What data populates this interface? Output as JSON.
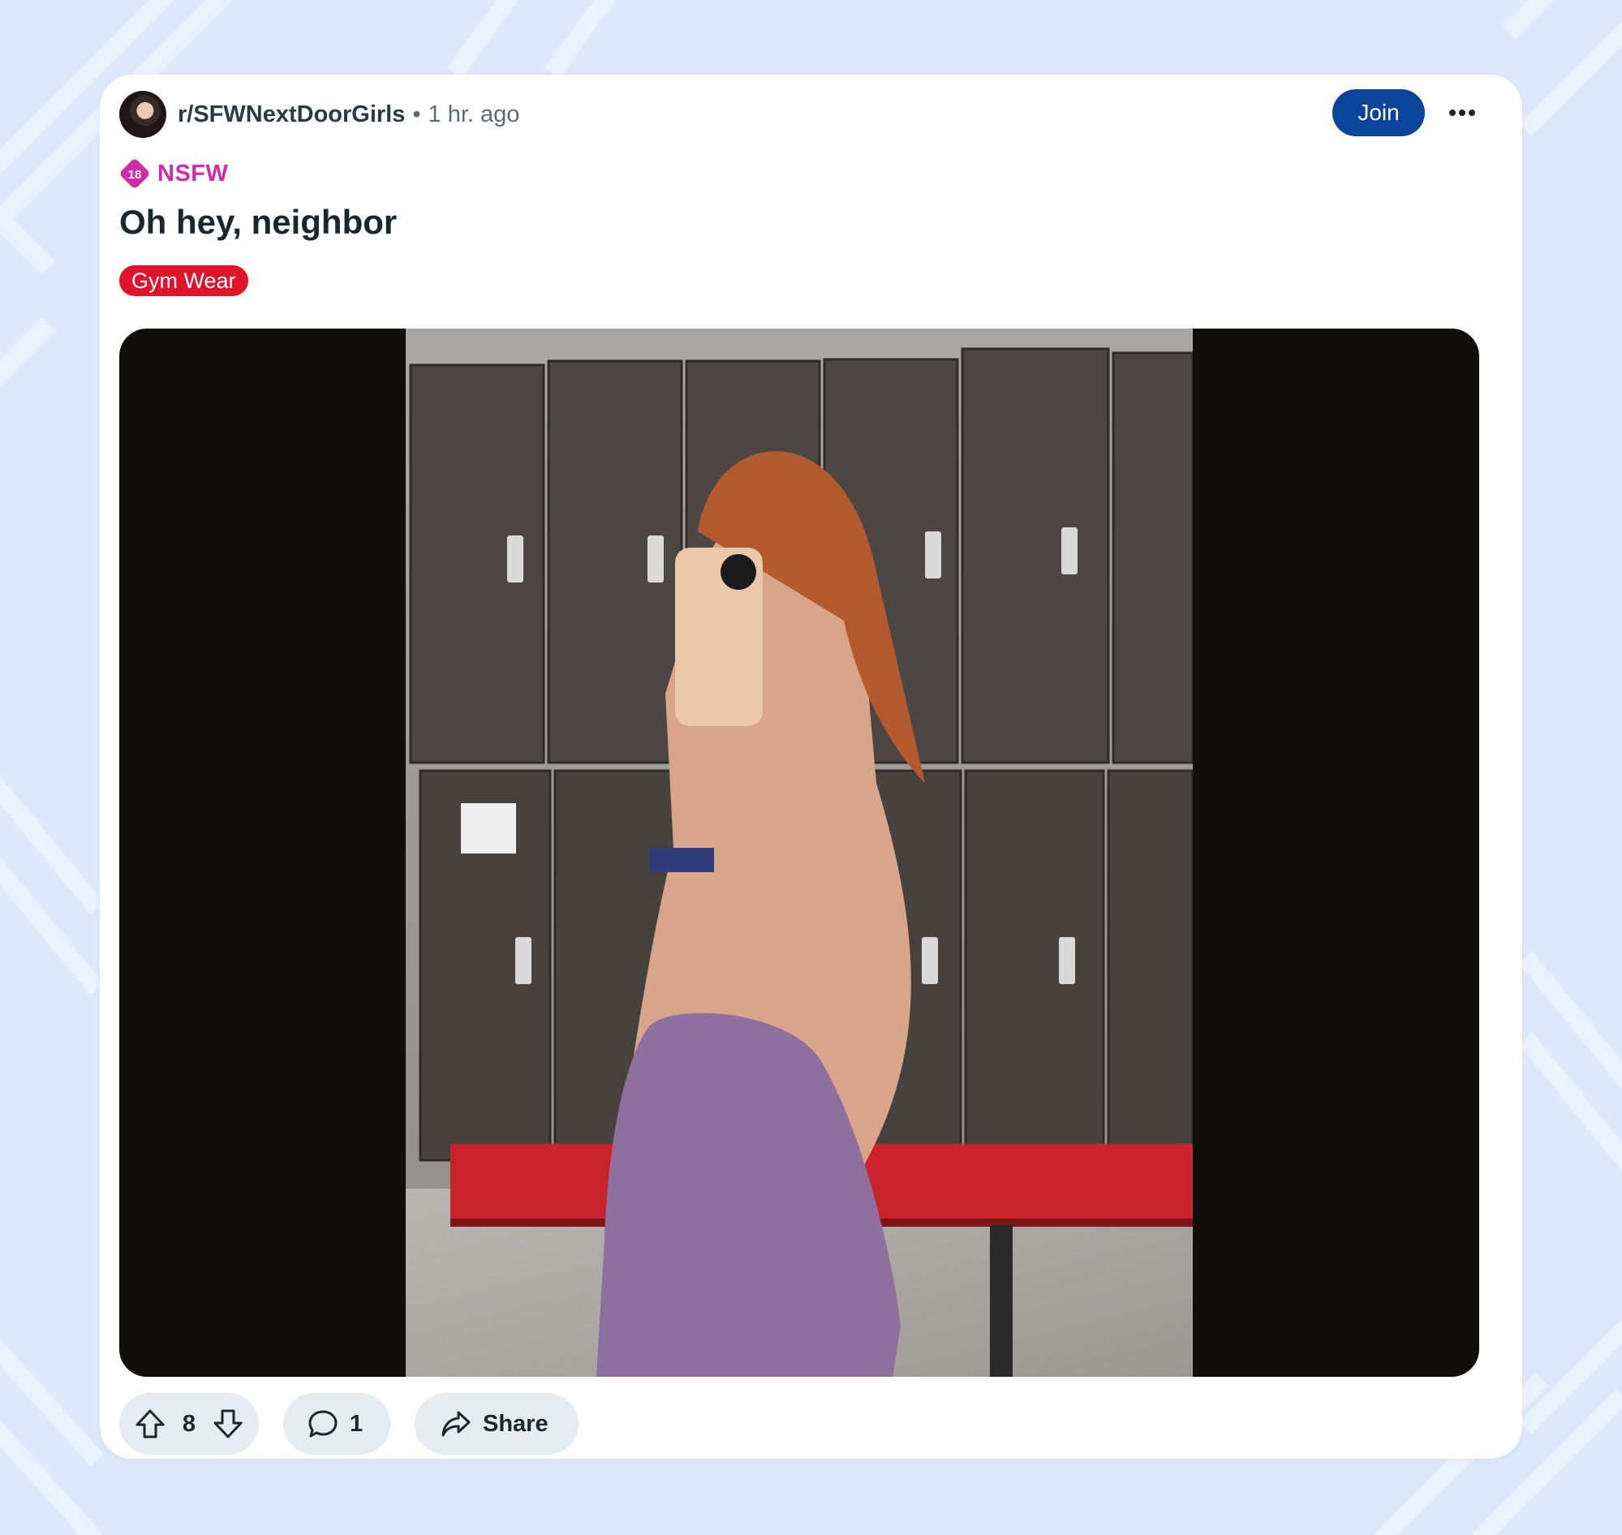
{
  "post": {
    "subreddit": "r/SFWNextDoorGirls",
    "separator": "•",
    "time": "1 hr. ago",
    "join_label": "Join",
    "nsfw_badge": "18",
    "nsfw_label": "NSFW",
    "title": "Oh hey, neighbor",
    "flair": "Gym Wear",
    "flair_color": "#e0122c"
  },
  "actions": {
    "upvotes": "8",
    "comments": "1",
    "share_label": "Share"
  },
  "colors": {
    "join_bg": "#0a449b",
    "nsfw": "#d22aa8",
    "page_bg": "#dce9fb",
    "pill_bg": "#e5ebee"
  },
  "icons": [
    "more-icon",
    "nsfw-18-icon",
    "upvote-icon",
    "downvote-icon",
    "comment-icon",
    "share-icon"
  ]
}
